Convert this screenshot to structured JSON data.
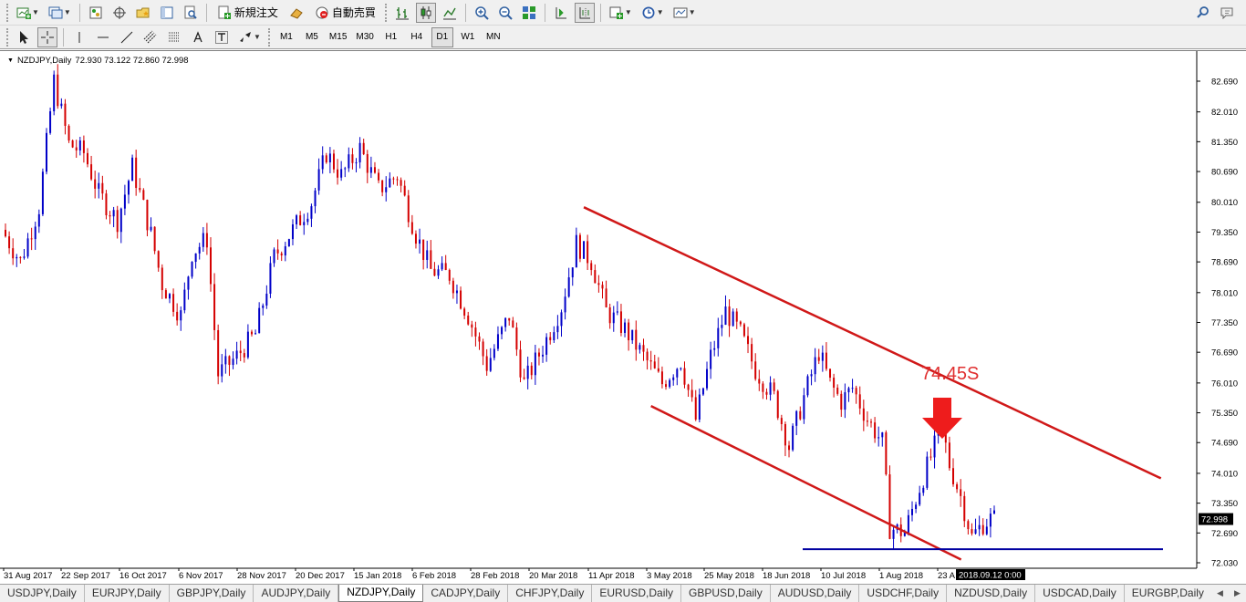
{
  "toolbar1": {
    "new_order_label": "新規注文",
    "auto_trade_label": "自動売買"
  },
  "toolbar2": {
    "timeframes": [
      "M1",
      "M5",
      "M15",
      "M30",
      "H1",
      "H4",
      "D1",
      "W1",
      "MN"
    ],
    "active_timeframe": "D1"
  },
  "chart_header": {
    "symbol": "NZDJPY,Daily",
    "ohlc": "72.930 73.122 72.860 72.998"
  },
  "annotation": {
    "text": "74.45S",
    "color": "#e03030"
  },
  "colors": {
    "bull": "#0000c8",
    "bear": "#d40000",
    "trendline": "#d01818",
    "support": "#0000a0",
    "arrow": "#ee1c1c"
  },
  "chart_data": {
    "type": "candlestick",
    "symbol": "NZDJPY",
    "timeframe": "Daily",
    "price_ticks": [
      "82.690",
      "82.010",
      "81.350",
      "80.690",
      "80.010",
      "79.350",
      "78.690",
      "78.010",
      "77.350",
      "76.690",
      "76.010",
      "75.350",
      "74.690",
      "74.010",
      "73.350",
      "72.690",
      "72.030"
    ],
    "current_price_label": "72.998",
    "date_labels": [
      "31 Aug 2017",
      "22 Sep 2017",
      "16 Oct 2017",
      "6 Nov 2017",
      "28 Nov 2017",
      "20 Dec 2017",
      "15 Jan 2018",
      "6 Feb 2018",
      "28 Feb 2018",
      "20 Mar 2018",
      "11 Apr 2018",
      "3 May 2018",
      "25 May 2018",
      "18 Jun 2018",
      "10 Jul 2018",
      "1 Aug 2018",
      "23 A"
    ],
    "cursor_date_label": "2018.09.12 0:00",
    "price_path": [
      [
        0,
        79.4
      ],
      [
        5,
        78.7
      ],
      [
        10,
        79.9
      ],
      [
        14,
        82.7
      ],
      [
        18,
        81.3
      ],
      [
        22,
        81.1
      ],
      [
        26,
        80.2
      ],
      [
        31,
        79.6
      ],
      [
        35,
        80.8
      ],
      [
        40,
        79.3
      ],
      [
        43,
        78.2
      ],
      [
        48,
        77.5
      ],
      [
        51,
        78.9
      ],
      [
        55,
        79.2
      ],
      [
        58,
        76.2
      ],
      [
        63,
        76.6
      ],
      [
        68,
        77.1
      ],
      [
        73,
        78.8
      ],
      [
        78,
        79.4
      ],
      [
        83,
        80.0
      ],
      [
        87,
        81.1
      ],
      [
        91,
        80.6
      ],
      [
        96,
        81.2
      ],
      [
        101,
        80.3
      ],
      [
        106,
        80.6
      ],
      [
        111,
        79.3
      ],
      [
        115,
        78.5
      ],
      [
        120,
        78.4
      ],
      [
        125,
        77.5
      ],
      [
        130,
        76.4
      ],
      [
        136,
        77.5
      ],
      [
        140,
        76.0
      ],
      [
        145,
        76.8
      ],
      [
        150,
        77.7
      ],
      [
        154,
        79.1
      ],
      [
        158,
        78.7
      ],
      [
        162,
        77.6
      ],
      [
        167,
        77.2
      ],
      [
        172,
        76.6
      ],
      [
        177,
        76.0
      ],
      [
        182,
        76.5
      ],
      [
        186,
        75.2
      ],
      [
        190,
        76.6
      ],
      [
        194,
        77.6
      ],
      [
        198,
        77.1
      ],
      [
        202,
        76.3
      ],
      [
        207,
        75.7
      ],
      [
        211,
        74.6
      ],
      [
        215,
        75.7
      ],
      [
        219,
        76.7
      ],
      [
        222,
        76.0
      ],
      [
        225,
        75.6
      ],
      [
        228,
        75.9
      ],
      [
        232,
        75.2
      ],
      [
        236,
        74.7
      ],
      [
        238,
        72.8
      ],
      [
        242,
        72.7
      ],
      [
        246,
        73.7
      ],
      [
        250,
        74.6
      ],
      [
        252,
        75.0
      ],
      [
        254,
        74.2
      ],
      [
        257,
        73.5
      ],
      [
        260,
        72.6
      ],
      [
        263,
        72.9
      ],
      [
        265,
        73.0
      ]
    ],
    "channel_upper": {
      "from": [
        155,
        79.9
      ],
      "to": [
        295,
        73.9
      ]
    },
    "channel_lower": {
      "from": [
        173,
        75.5
      ],
      "to": [
        250,
        72.1
      ]
    },
    "support_level": 72.33,
    "grid": false,
    "legend": "none"
  },
  "tabs": [
    "USDJPY,Daily",
    "EURJPY,Daily",
    "GBPJPY,Daily",
    "AUDJPY,Daily",
    "NZDJPY,Daily",
    "CADJPY,Daily",
    "CHFJPY,Daily",
    "EURUSD,Daily",
    "GBPUSD,Daily",
    "AUDUSD,Daily",
    "USDCHF,Daily",
    "NZDUSD,Daily",
    "USDCAD,Daily",
    "EURGBP,Daily"
  ],
  "active_tab": "NZDJPY,Daily"
}
